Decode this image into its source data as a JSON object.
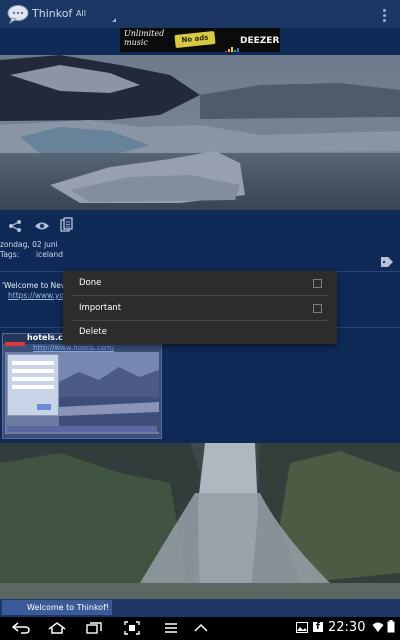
{
  "action_bar": {
    "app_name": "Thinkof",
    "filter": "All",
    "logo_icon": "speech-bubble-icon",
    "overflow_icon": "overflow-menu-icon"
  },
  "ad": {
    "line1": "Unlimited",
    "line2": "music",
    "badge": "No ads",
    "brand": "DEEZER"
  },
  "note": {
    "date": "zondag, 02 juni",
    "tags_label": "Tags:",
    "tag": "iceland",
    "title": "'Welcome to New",
    "link": "https://www.your",
    "icons": [
      "share-icon",
      "eye-icon",
      "copy-icon",
      "tag-icon"
    ]
  },
  "thumbnail": {
    "title": "hotels.com",
    "url": "http://www.hotels.com/"
  },
  "context_menu": {
    "items": [
      {
        "label": "Done",
        "checkable": true,
        "checked": false
      },
      {
        "label": "Important",
        "checkable": true,
        "checked": false
      },
      {
        "label": "Delete",
        "checkable": false
      }
    ]
  },
  "bottom": {
    "title": "Welcome to Thinkof!"
  },
  "status_bar": {
    "time": "22:30",
    "icons": [
      "back-icon",
      "home-icon",
      "recent-apps-icon",
      "screenshot-icon",
      "menu-icon",
      "up-icon",
      "gallery-notification-icon",
      "facebook-notification-icon",
      "wifi-icon",
      "battery-icon"
    ]
  },
  "colors": {
    "background": "#102a57",
    "menu_background": "#2c2c2c",
    "accent_yellow": "#d7c941"
  }
}
